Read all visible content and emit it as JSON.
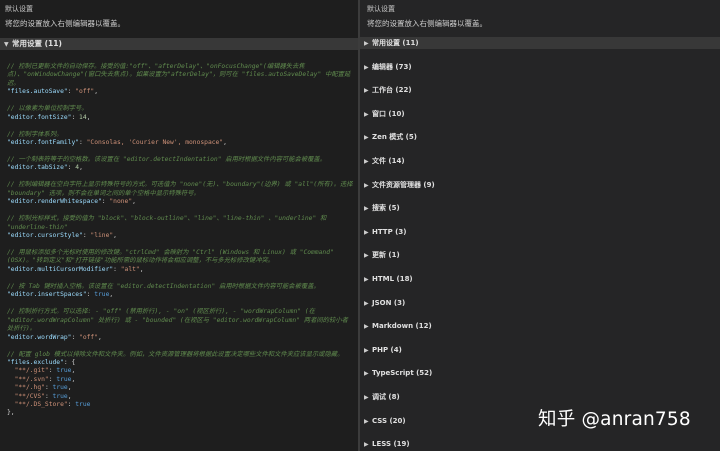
{
  "left": {
    "title": "默认设置",
    "description": "将您的设置放入右侧编辑器以覆盖。",
    "group": "常用设置 (11)",
    "settings": [
      {
        "comment": "// 控制已更新文件的自动保存。接受的值:\"off\"、\"afterDelay\"、\"onFocusChange\"(编辑器失去焦点)、\"onWindowChange\"(窗口失去焦点)。如果设置为\"afterDelay\"，则可在 \"files.autoSaveDelay\" 中配置延迟。",
        "key": "\"files.autoSave\"",
        "value": "\"off\"",
        "vtype": "s"
      },
      {
        "comment": "// 以像素为单位控制字号。",
        "key": "\"editor.fontSize\"",
        "value": "14",
        "vtype": "n"
      },
      {
        "comment": "// 控制字体系列。",
        "key": "\"editor.fontFamily\"",
        "value": "\"Consolas, 'Courier New', monospace\"",
        "vtype": "s"
      },
      {
        "comment": "// 一个制表符等于的空格数。该设置在 \"editor.detectIndentation\" 启用时根据文件内容可能会被覆盖。",
        "key": "\"editor.tabSize\"",
        "value": "4",
        "vtype": "n"
      },
      {
        "comment": "// 控制编辑器在空白字符上显示特殊符号的方式。可选值为 \"none\"(无)、\"boundary\"(边界) 或 \"all\"(所有)。选择 \"boundary\" 选项，则不会在单词之间的单个空格中显示特殊符号。",
        "key": "\"editor.renderWhitespace\"",
        "value": "\"none\"",
        "vtype": "s"
      },
      {
        "comment": "// 控制光标样式，接受的值为 \"block\"、\"block-outline\"、\"line\"、\"line-thin\" 、\"underline\" 和 \"underline-thin\"",
        "key": "\"editor.cursorStyle\"",
        "value": "\"line\"",
        "vtype": "s"
      },
      {
        "comment": "// 用鼠标添加多个光标时使用的修改键。\"ctrlCmd\" 会映射为 \"Ctrl\" (Windows 和 Linux) 或 \"Command\" (OSX)。\"转到定义\"和\"打开链接\"功能所需的鼠标动作将会相应调整，不与多光标修改键冲突。",
        "key": "\"editor.multiCursorModifier\"",
        "value": "\"alt\"",
        "vtype": "s"
      },
      {
        "comment": "// 按 Tab 键时插入空格。该设置在 \"editor.detectIndentation\" 启用时根据文件内容可能会被覆盖。",
        "key": "\"editor.insertSpaces\"",
        "value": "true",
        "vtype": "b"
      },
      {
        "comment": "// 控制折行方式。可以选择: - \"off\" (禁用折行), - \"on\" (视区折行), - \"wordWrapColumn\" (在 \"editor.wordWrapColumn\" 处折行) 或 - \"bounded\" (在视区与 \"editor.wordWrapColumn\" 两者间的较小者处折行)。",
        "key": "\"editor.wordWrap\"",
        "value": "\"off\"",
        "vtype": "s"
      }
    ],
    "exclude": {
      "comment": "// 配置 glob 模式以排除文件和文件夹。例如，文件资源管理器将根据此设置决定哪些文件和文件夹应该显示或隐藏。",
      "key": "\"files.exclude\"",
      "entries": [
        {
          "key": "\"**/.git\"",
          "value": "true"
        },
        {
          "key": "\"**/.svn\"",
          "value": "true"
        },
        {
          "key": "\"**/.hg\"",
          "value": "true"
        },
        {
          "key": "\"**/CVS\"",
          "value": "true"
        },
        {
          "key": "\"**/.DS_Store\"",
          "value": "true"
        }
      ],
      "close": "},"
    }
  },
  "right": {
    "title": "默认设置",
    "description": "将您的设置放入右侧编辑器以覆盖。",
    "categories": [
      "常用设置 (11)",
      "编辑器 (73)",
      "工作台 (22)",
      "窗口 (10)",
      "Zen 模式 (5)",
      "文件 (14)",
      "文件资源管理器 (9)",
      "搜索 (5)",
      "HTTP (3)",
      "更新 (1)",
      "HTML (18)",
      "JSON (3)",
      "Markdown (12)",
      "PHP (4)",
      "TypeScript (52)",
      "调试 (8)",
      "CSS (20)",
      "LESS (19)"
    ]
  },
  "watermark": "知乎 @anran758",
  "colors": {
    "background": "#1e1e1e",
    "panel": "#252526",
    "comment": "#608b4e",
    "key": "#9cdcfe",
    "string": "#ce9178",
    "number": "#b5cea8",
    "boolean": "#569cd6"
  }
}
